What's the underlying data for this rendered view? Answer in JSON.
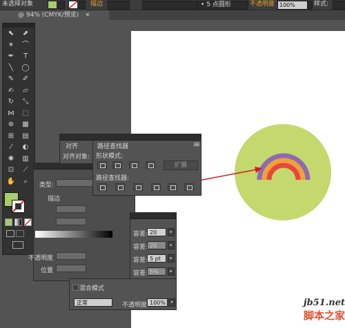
{
  "control_bar": {
    "selection_label": "未选择对象",
    "stroke_label": "描边",
    "brush_value": "5 点圆形",
    "opacity_label": "不透明度",
    "opacity_value": "100%",
    "style_label": "样式:"
  },
  "document_tab": {
    "title": "@ 94% (CMYK/预览)",
    "close_symbol": "×"
  },
  "tools": [
    {
      "name": "selection-tool-icon",
      "glyph": "⬉"
    },
    {
      "name": "direct-selection-tool-icon",
      "glyph": "⬈"
    },
    {
      "name": "magic-wand-tool-icon",
      "glyph": "✶"
    },
    {
      "name": "lasso-tool-icon",
      "glyph": "⌒"
    },
    {
      "name": "pen-tool-icon",
      "glyph": "✒"
    },
    {
      "name": "type-tool-icon",
      "glyph": "T"
    },
    {
      "name": "line-tool-icon",
      "glyph": "╲"
    },
    {
      "name": "ellipse-tool-icon",
      "glyph": "◯"
    },
    {
      "name": "paintbrush-tool-icon",
      "glyph": "✎"
    },
    {
      "name": "pencil-tool-icon",
      "glyph": "✐"
    },
    {
      "name": "blob-brush-tool-icon",
      "glyph": "✍"
    },
    {
      "name": "eraser-tool-icon",
      "glyph": "▱"
    },
    {
      "name": "rotate-tool-icon",
      "glyph": "↻"
    },
    {
      "name": "scale-tool-icon",
      "glyph": "⤡"
    },
    {
      "name": "width-tool-icon",
      "glyph": "⋈"
    },
    {
      "name": "free-transform-tool-icon",
      "glyph": "⬚"
    },
    {
      "name": "shape-builder-tool-icon",
      "glyph": "⊕"
    },
    {
      "name": "perspective-grid-tool-icon",
      "glyph": "▦"
    },
    {
      "name": "mesh-tool-icon",
      "glyph": "⊞"
    },
    {
      "name": "gradient-tool-icon",
      "glyph": "▤"
    },
    {
      "name": "eyedropper-tool-icon",
      "glyph": "⁄"
    },
    {
      "name": "blend-tool-icon",
      "glyph": "◐"
    },
    {
      "name": "symbol-sprayer-tool-icon",
      "glyph": "✺"
    },
    {
      "name": "column-graph-tool-icon",
      "glyph": "▥"
    },
    {
      "name": "artboard-tool-icon",
      "glyph": "⊡"
    },
    {
      "name": "slice-tool-icon",
      "glyph": "⟋"
    },
    {
      "name": "hand-tool-icon",
      "glyph": "✋"
    },
    {
      "name": "zoom-tool-icon",
      "glyph": "⌕"
    }
  ],
  "colors": {
    "fill": "#a8cc6a",
    "circle": "#c5d86d",
    "arc_outer": "#8e6bb0",
    "arc_middle": "#f0a13a",
    "arc_inner": "#e8463e",
    "arrow": "#cc1f1f"
  },
  "align_panel": {
    "tab_label": "对齐",
    "align_to_label": "对齐对象:"
  },
  "pathfinder_panel": {
    "tab_label": "路径查找器",
    "shape_modes_label": "形状模式:",
    "expand_button": "扩展",
    "pathfinders_label": "路径查找器:"
  },
  "stroke_panel": {
    "type_label": "类型:",
    "stroke_label": "描边",
    "opacity_label": "不透明度",
    "position_label": "位置"
  },
  "tolerance_panel": {
    "rows": [
      {
        "label": "容差:",
        "value": "20"
      },
      {
        "label": "容差:",
        "value": "20"
      },
      {
        "label": "容差:",
        "value": "5 pt"
      },
      {
        "label": "容差:",
        "value": "5%"
      }
    ]
  },
  "transparency_panel": {
    "blend_section_label": "混合模式",
    "blend_mode": "正常",
    "opacity_label": "不透明度:",
    "opacity_value": "100%"
  },
  "watermark": {
    "domain": "jb51.net",
    "name": "脚本之家"
  }
}
